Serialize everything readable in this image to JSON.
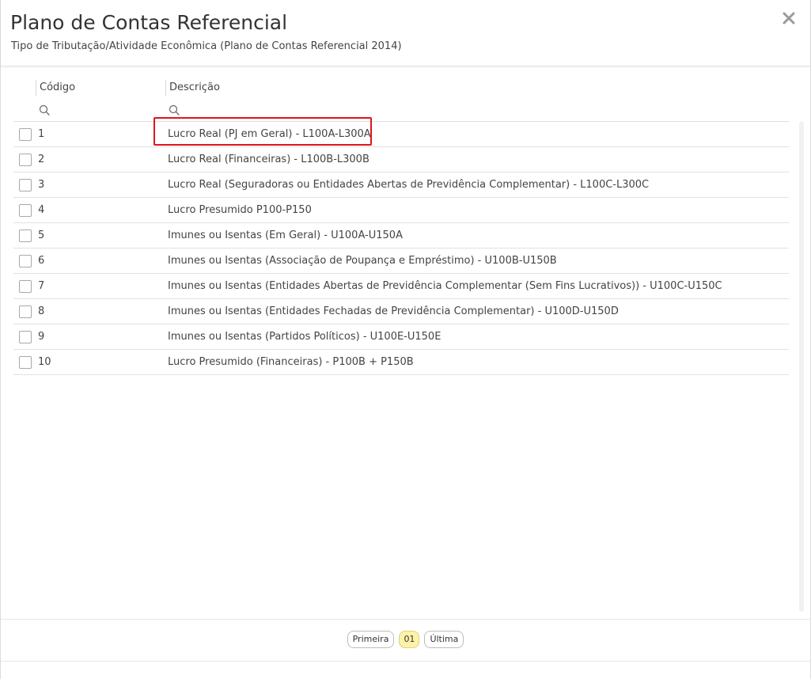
{
  "modal": {
    "title": "Plano de Contas Referencial",
    "subtitle": "Tipo de Tributação/Atividade Econômica (Plano de Contas Referencial 2014)",
    "close_icon": "close-icon"
  },
  "table": {
    "columns": [
      "Código",
      "Descrição"
    ],
    "search_icon": "search-icon",
    "rows": [
      {
        "code": "1",
        "desc": "Lucro Real (PJ em Geral) - L100A-L300A"
      },
      {
        "code": "2",
        "desc": "Lucro Real (Financeiras) - L100B-L300B"
      },
      {
        "code": "3",
        "desc": "Lucro Real (Seguradoras ou Entidades Abertas de Previdência Complementar) - L100C-L300C"
      },
      {
        "code": "4",
        "desc": "Lucro Presumido P100-P150"
      },
      {
        "code": "5",
        "desc": "Imunes ou Isentas (Em Geral) - U100A-U150A"
      },
      {
        "code": "6",
        "desc": "Imunes ou Isentas (Associação de Poupança e Empréstimo) - U100B-U150B"
      },
      {
        "code": "7",
        "desc": "Imunes ou Isentas (Entidades Abertas de Previdência Complementar (Sem Fins Lucrativos)) - U100C-U150C"
      },
      {
        "code": "8",
        "desc": "Imunes ou Isentas (Entidades Fechadas de Previdência Complementar) - U100D-U150D"
      },
      {
        "code": "9",
        "desc": "Imunes ou Isentas (Partidos Políticos) - U100E-U150E"
      },
      {
        "code": "10",
        "desc": "Lucro Presumido (Financeiras) - P100B + P150B"
      }
    ]
  },
  "pager": {
    "first": "Primeira",
    "current": "01",
    "last": "Última"
  },
  "colors": {
    "highlight": "#e0141e",
    "active_page": "#fdf2a8"
  }
}
